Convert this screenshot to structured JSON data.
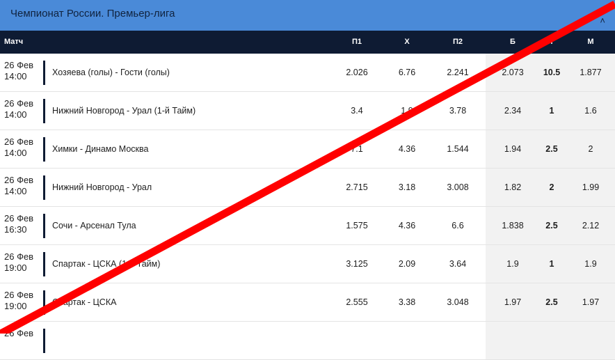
{
  "header": {
    "title": "Чемпионат России. Премьер-лига",
    "collapse_icon": "chevron-up-icon"
  },
  "columns": {
    "match": "Матч",
    "p1": "П1",
    "x": "Х",
    "p2": "П2",
    "b": "Б",
    "t": "Т",
    "m": "М"
  },
  "rows": [
    {
      "date": "26 Фев",
      "time": "14:00",
      "name": "Хозяева (голы) - Гости (голы)",
      "p1": "2.026",
      "x": "6.76",
      "p2": "2.241",
      "b": "2.073",
      "t": "10.5",
      "m": "1.877"
    },
    {
      "date": "26 Фев",
      "time": "14:00",
      "name": "Нижний Новгород - Урал (1-й Тайм)",
      "p1": "3.4",
      "x": "1.9",
      "p2": "3.78",
      "b": "2.34",
      "t": "1",
      "m": "1.6"
    },
    {
      "date": "26 Фев",
      "time": "14:00",
      "name": "Химки - Динамо Москва",
      "p1": "7.1",
      "x": "4.36",
      "p2": "1.544",
      "b": "1.94",
      "t": "2.5",
      "m": "2"
    },
    {
      "date": "26 Фев",
      "time": "14:00",
      "name": "Нижний Новгород - Урал",
      "p1": "2.715",
      "x": "3.18",
      "p2": "3.008",
      "b": "1.82",
      "t": "2",
      "m": "1.99"
    },
    {
      "date": "26 Фев",
      "time": "16:30",
      "name": "Сочи - Арсенал Тула",
      "p1": "1.575",
      "x": "4.36",
      "p2": "6.6",
      "b": "1.838",
      "t": "2.5",
      "m": "2.12"
    },
    {
      "date": "26 Фев",
      "time": "19:00",
      "name": "Спартак - ЦСКА (1-й Тайм)",
      "p1": "3.125",
      "x": "2.09",
      "p2": "3.64",
      "b": "1.9",
      "t": "1",
      "m": "1.9"
    },
    {
      "date": "26 Фев",
      "time": "19:00",
      "name": "Спартак - ЦСКА",
      "p1": "2.555",
      "x": "3.38",
      "p2": "3.048",
      "b": "1.97",
      "t": "2.5",
      "m": "1.97"
    },
    {
      "date": "26 Фев",
      "time": "",
      "name": "",
      "p1": "",
      "x": "",
      "p2": "",
      "b": "",
      "t": "",
      "m": ""
    }
  ],
  "overlay": {
    "strike_color": "#ff0000"
  }
}
